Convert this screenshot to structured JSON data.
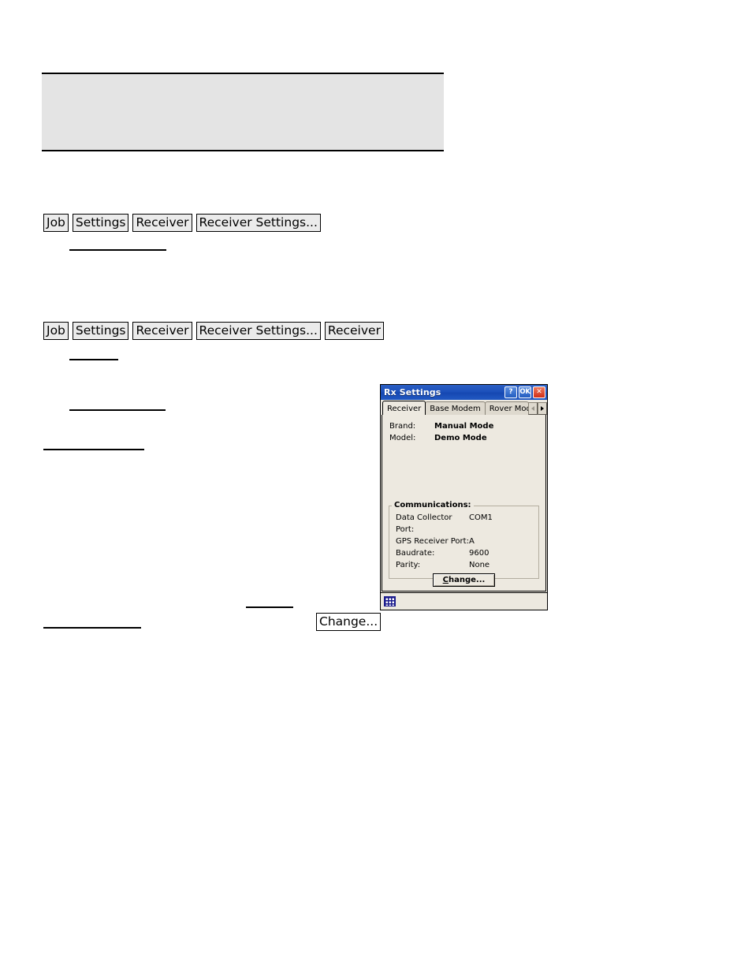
{
  "note_block": {
    "text": ""
  },
  "breadcrumbs": [
    {
      "id": "breadcrumb-1",
      "crumbs": [
        "Job",
        "Settings",
        "Receiver",
        "Receiver Settings..."
      ]
    },
    {
      "id": "breadcrumb-2",
      "crumbs": [
        "Job",
        "Settings",
        "Receiver",
        "Receiver Settings...",
        "Receiver"
      ]
    }
  ],
  "inline_button": {
    "label": "Change..."
  },
  "dialog": {
    "title": "Rx Settings",
    "titlebar_buttons": {
      "help": "?",
      "ok": "OK",
      "close": "✕"
    },
    "tabs": [
      {
        "label": "Receiver",
        "selected": true
      },
      {
        "label": "Base Modem",
        "selected": false
      },
      {
        "label": "Rover Mod",
        "selected": false
      }
    ],
    "tab_scroll": {
      "left": "◂",
      "right": "▸"
    },
    "receiver_fields": [
      {
        "label": "Brand:",
        "value": "Manual Mode"
      },
      {
        "label": "Model:",
        "value": "Demo Mode"
      }
    ],
    "communications": {
      "legend": "Communications:",
      "rows": [
        {
          "label": "Data Collector Port:",
          "value": "COM1"
        },
        {
          "label": "GPS Receiver Port:",
          "value": "A"
        },
        {
          "label": "Baudrate:",
          "value": "9600"
        },
        {
          "label": "Parity:",
          "value": "None"
        }
      ],
      "change_button": {
        "accel": "C",
        "rest": "hange..."
      }
    },
    "taskbar": {
      "sip_icon": "keyboard-icon"
    },
    "colors": {
      "titlebar_blue": "#1c50bb",
      "close_red": "#cf2e17",
      "client_beige": "#ede9e0",
      "tab_inactive": "#ded9ce"
    }
  }
}
